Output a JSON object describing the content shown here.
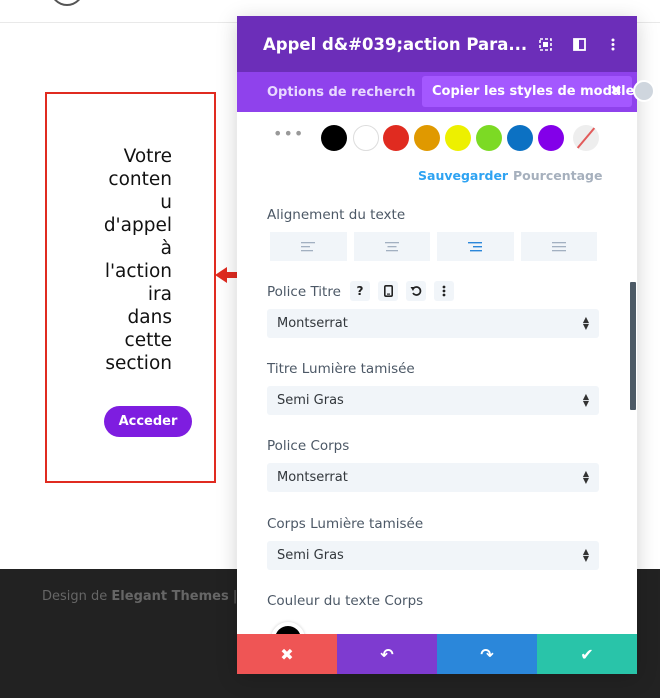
{
  "page": {
    "cta": {
      "text_lines": [
        "Votre",
        "conten",
        "u",
        "d'appel",
        "à",
        "l'action",
        "ira",
        "dans",
        "cette",
        "section"
      ],
      "button_label": "Acceder"
    },
    "footer": {
      "prefix": "Design de",
      "brand": "Elegant Themes",
      "sep": "|"
    }
  },
  "panel": {
    "title": "Appel d&#039;action Para...",
    "header_icons": [
      "expand-icon",
      "split-view-icon",
      "more-vertical-icon"
    ],
    "tabs": {
      "options_label": "Options de recherch",
      "copy_label": "Copier les styles de module",
      "copy_close": "✖"
    },
    "color_picker": {
      "dots": "•••",
      "swatches": [
        "#000000",
        "#ffffff",
        "#e02b20",
        "#e09900",
        "#edf000",
        "#7cda24",
        "#0c71c3",
        "#8300e9"
      ],
      "save_label": "Sauvegarder",
      "percent_label": "Pourcentage"
    },
    "settings": {
      "text_align_label": "Alignement du texte",
      "align_options": [
        "left",
        "center",
        "right",
        "justify"
      ],
      "align_selected": "right",
      "title_font_label": "Police Titre",
      "title_font_value": "Montserrat",
      "title_weight_label": "Titre Lumière tamisée",
      "title_weight_value": "Semi Gras",
      "body_font_label": "Police Corps",
      "body_font_value": "Montserrat",
      "body_weight_label": "Corps Lumière tamisée",
      "body_weight_value": "Semi Gras",
      "body_color_label": "Couleur du texte Corps",
      "body_color_value": "#000000",
      "label_icon_help": "?"
    },
    "footer_buttons": [
      {
        "name": "cancel",
        "icon": "✖",
        "color": "#ef5555"
      },
      {
        "name": "undo",
        "icon": "↶",
        "color": "#7e3bd0"
      },
      {
        "name": "redo",
        "icon": "↷",
        "color": "#2b87da"
      },
      {
        "name": "save",
        "icon": "✔",
        "color": "#29c4a9"
      }
    ]
  }
}
